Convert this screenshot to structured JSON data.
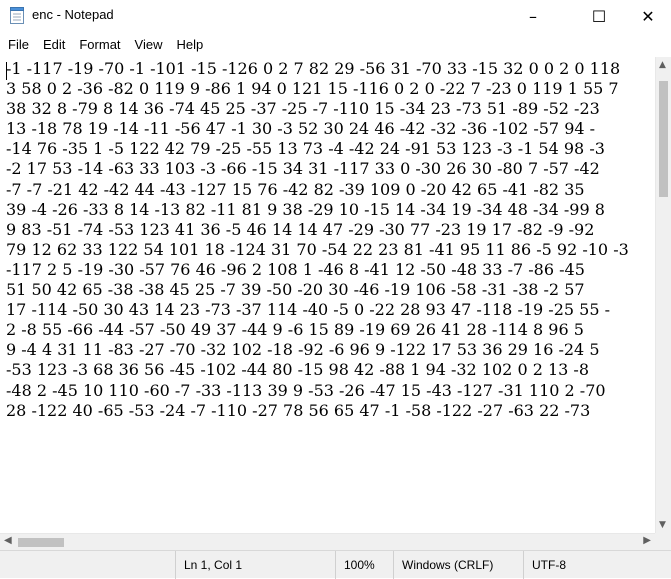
{
  "window": {
    "title": "enc - Notepad",
    "minimize_glyph": "–",
    "maximize_glyph": "☐",
    "close_glyph": "✕",
    "icon": "notepad-icon"
  },
  "menu": [
    "File",
    "Edit",
    "Format",
    "View",
    "Help"
  ],
  "editor": {
    "lines": [
      "-1 -117 -19 -70 -1 -101 -15 -126 0 2 7 82 29 -56 31 -70 33 -15 32 0 0 2 0 118",
      "3 58 0 2 -36 -82 0 119 9 -86 1 94 0 121 15 -116 0 2 0 -22 7 -23 0 119 1 55 7",
      "38 32 8 -79 8 14 36 -74 45 25 -37 -25 -7 -110 15 -34 23 -73 51 -89 -52 -23",
      "13 -18 78 19 -14 -11 -56 47 -1 30 -3 52 30 24 46 -42 -32 -36 -102 -57 94 -",
      "-14 76 -35 1 -5 122 42 79 -25 -55 13 73 -4 -42 24 -91 53 123 -3 -1 54 98 -3",
      "-2 17 53 -14 -63 33 103 -3 -66 -15 34 31 -117 33 0 -30 26 30 -80 7 -57 -42",
      "-7 -7 -21 42 -42 44 -43 -127 15 76 -42 82 -39 109 0 -20 42 65 -41 -82 35",
      "39 -4 -26 -33 8 14 -13 82 -11 81 9 38 -29 10 -15 14 -34 19 -34 48 -34 -99 8",
      "9 83 -51 -74 -53 123 41 36 -5 46 14 14 47 -29 -30 77 -23 19 17 -82 -9 -92",
      "79 12 62 33 122 54 101 18 -124 31 70 -54 22 23 81 -41 95 11 86 -5 92 -10 -3",
      "-117 2 5 -19 -30 -57 76 46 -96 2 108 1 -46 8 -41 12 -50 -48 33 -7 -86 -45",
      "51 50 42 65 -38 -38 45 25 -7 39 -50 -20 30 -46 -19 106 -58 -31 -38 -2 57",
      "17 -114 -50 30 43 14 23 -73 -37 114 -40 -5 0 -22 28 93 47 -118 -19 -25 55 -",
      "2 -8 55 -66 -44 -57 -50 49 37 -44 9 -6 15 89 -19 69 26 41 28 -114 8 96 5",
      "9 -4 4 31 11 -83 -27 -70 -32 102 -18 -92 -6 96 9 -122 17 53 36 29 16 -24 5",
      "-53 123 -3 68 36 56 -45 -102 -44 80 -15 98 42 -88 1 94 -32 102 0 2 13 -8",
      "-48 2 -45 10 110 -60 -7 -33 -113 39 9 -53 -26 -47 15 -43 -127 -31 110 2 -70",
      "28 -122 40 -65 -53 -24 -7 -110 -27 78 56 65 47 -1 -58 -122 -27 -63 22 -73"
    ]
  },
  "scrollbars": {
    "up_arrow": "▲",
    "down_arrow": "▼",
    "left_arrow": "◀",
    "right_arrow": "▶"
  },
  "status": {
    "position": "Ln 1, Col 1",
    "zoom": "100%",
    "line_ending": "Windows (CRLF)",
    "encoding": "UTF-8"
  },
  "colors": {
    "status_bar_bg": "#f0f0f0",
    "scroll_thumb": "#c1c1c1"
  }
}
